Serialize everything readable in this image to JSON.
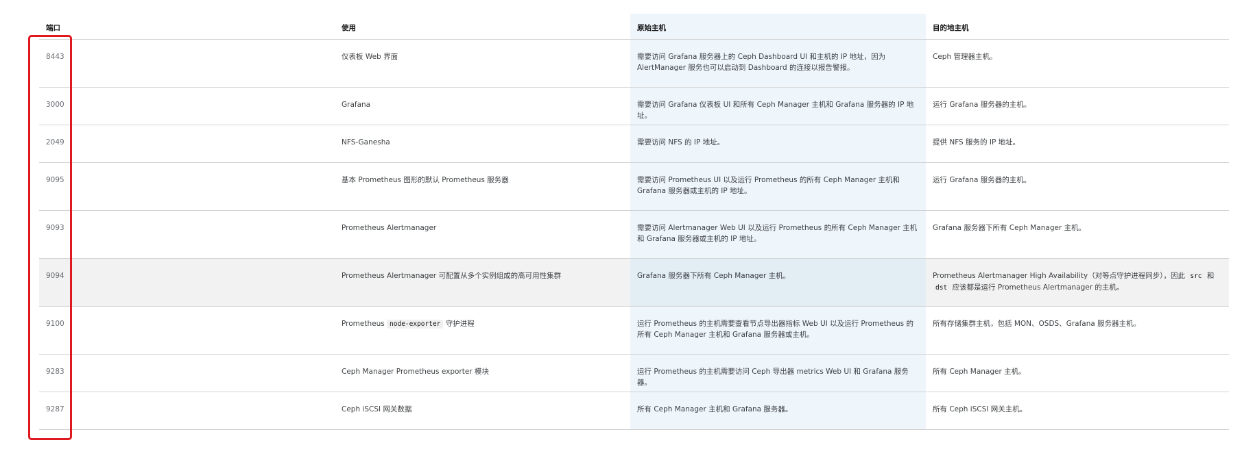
{
  "table": {
    "headers": {
      "port": "端口",
      "usage": "使用",
      "source": "原始主机",
      "destination": "目的地主机"
    },
    "rows": [
      {
        "port": "8443",
        "usage": "仪表板 Web 界面",
        "source": "需要访问 Grafana 服务器上的 Ceph Dashboard UI 和主机的 IP 地址，因为 AlertManager 服务也可以启动到 Dashboard 的连接以报告警报。",
        "destination": "Ceph 管理器主机。"
      },
      {
        "port": "3000",
        "usage": "Grafana",
        "source": "需要访问 Grafana 仪表板 UI 和所有 Ceph Manager 主机和 Grafana 服务器的 IP 地址。",
        "destination": "运行 Grafana 服务器的主机。"
      },
      {
        "port": "2049",
        "usage": "NFS-Ganesha",
        "source": "需要访问 NFS 的 IP 地址。",
        "destination": "提供 NFS 服务的 IP 地址。"
      },
      {
        "port": "9095",
        "usage": "基本 Prometheus 图形的默认 Prometheus 服务器",
        "source": "需要访问 Prometheus UI 以及运行 Prometheus 的所有 Ceph Manager 主机和 Grafana 服务器或主机的 IP 地址。",
        "destination": "运行 Grafana 服务器的主机。"
      },
      {
        "port": "9093",
        "usage": "Prometheus Alertmanager",
        "source": "需要访问 Alertmanager Web UI 以及运行 Prometheus 的所有 Ceph Manager 主机和 Grafana 服务器或主机的 IP 地址。",
        "destination": "Grafana 服务器下所有 Ceph Manager 主机。"
      },
      {
        "port": "9094",
        "usage": "Prometheus Alertmanager 可配置从多个实例组成的高可用性集群",
        "source": "Grafana 服务器下所有 Ceph Manager 主机。",
        "destination_before": "Prometheus Alertmanager High Availability（对等点守护进程同步），因此 ",
        "destination_code1": "src",
        "destination_mid": " 和 ",
        "destination_code2": "dst",
        "destination_after": " 应该都是运行 Prometheus Alertmanager 的主机。"
      },
      {
        "port": "9100",
        "usage_before": "Prometheus ",
        "usage_code": "node-exporter",
        "usage_after": " 守护进程",
        "source": "运行 Prometheus 的主机需要查看节点导出器指标 Web UI 以及运行 Prometheus 的所有 Ceph Manager 主机和 Grafana 服务器或主机。",
        "destination": "所有存储集群主机，包括 MON、OSDS、Grafana 服务器主机。"
      },
      {
        "port": "9283",
        "usage": "Ceph Manager Prometheus exporter 模块",
        "source": "运行 Prometheus 的主机需要访问 Ceph 导出器 metrics Web UI 和 Grafana 服务器。",
        "destination": "所有 Ceph Manager 主机。"
      },
      {
        "port": "9287",
        "usage": "Ceph iSCSI 网关数据",
        "source": "所有 Ceph Manager 主机和 Grafana 服务器。",
        "destination": "所有 Ceph iSCSI 网关主机。"
      }
    ]
  },
  "colors": {
    "highlight_border": "#e0191e",
    "source_column_bg": "#eef5fb",
    "highlighted_row_bg": "#f2f2f2",
    "border": "#d2d2d2"
  }
}
